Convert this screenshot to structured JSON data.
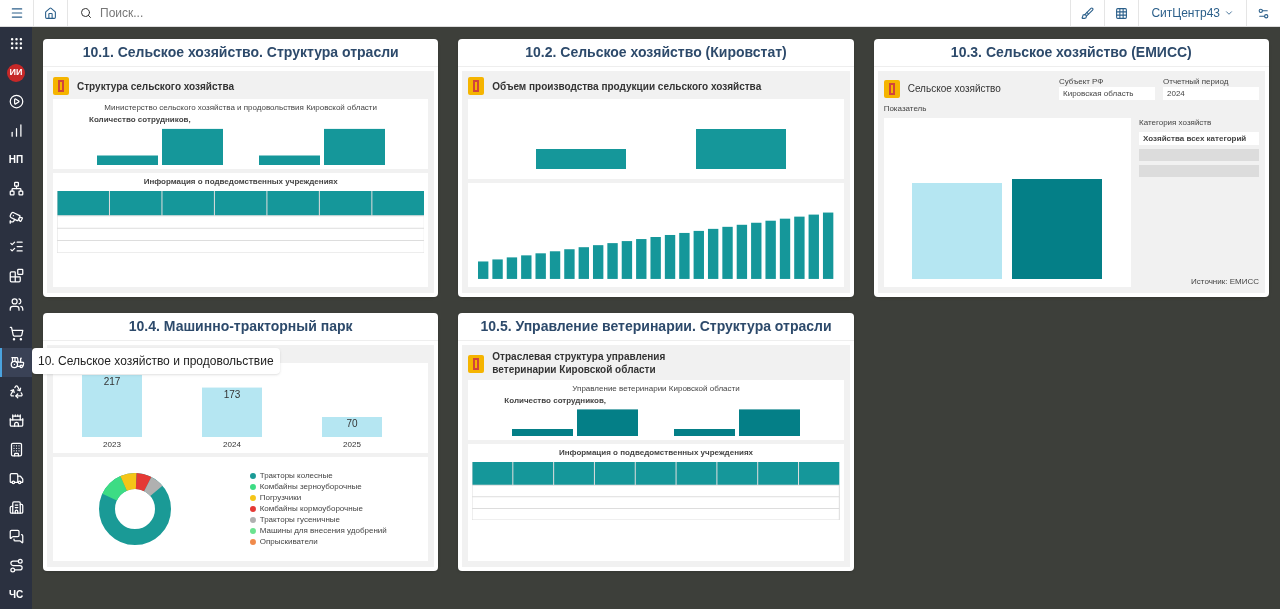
{
  "topbar": {
    "search_placeholder": "Поиск...",
    "user": "СитЦентр43"
  },
  "sidebar": {
    "items": [
      {
        "kind": "icon",
        "selected": false
      },
      {
        "kind": "badge",
        "label": "ИИ",
        "selected": false
      },
      {
        "kind": "icon",
        "selected": false
      },
      {
        "kind": "icon",
        "selected": false
      },
      {
        "kind": "text",
        "label": "НП",
        "selected": false
      },
      {
        "kind": "icon",
        "selected": false
      },
      {
        "kind": "icon",
        "selected": false
      },
      {
        "kind": "icon",
        "selected": false
      },
      {
        "kind": "icon",
        "selected": false
      },
      {
        "kind": "icon",
        "selected": false
      },
      {
        "kind": "icon",
        "selected": false
      },
      {
        "kind": "icon",
        "selected": true
      },
      {
        "kind": "icon",
        "selected": false
      },
      {
        "kind": "icon",
        "selected": false
      },
      {
        "kind": "icon",
        "selected": false
      },
      {
        "kind": "icon",
        "selected": false
      },
      {
        "kind": "icon",
        "selected": false
      },
      {
        "kind": "icon",
        "selected": false
      },
      {
        "kind": "icon",
        "selected": false
      },
      {
        "kind": "text",
        "label": "ЧС",
        "selected": false
      }
    ],
    "tooltip": "10. Сельское хозяйство и продовольствие"
  },
  "cards": [
    {
      "kind": "structure",
      "title": "10.1. Сельское хозяйство. Структура отрасли",
      "heading": "Структура сельского хозяйства",
      "subtitle": "Министерство сельского хозяйства и продовольствия Кировской области",
      "metric": "Количество сотрудников,",
      "table_title": "Информация о подведомственных учреждениях"
    },
    {
      "kind": "production",
      "title": "10.2. Сельское хозяйство (Кировстат)",
      "heading": "Объем производства продукции сельского хозяйства"
    },
    {
      "kind": "emiss",
      "title": "10.3. Сельское хозяйство (ЕМИСС)",
      "heading": "Сельское хозяйство",
      "filters": [
        {
          "label": "Субъект РФ",
          "value": "Кировская область"
        },
        {
          "label": "Отчетный период",
          "value": "2024"
        }
      ],
      "indicator_label": "Показатель",
      "side_label": "Категория хозяйств",
      "side_value": "Хозяйства всех категорий",
      "source": "Источник: ЕМИСС"
    },
    {
      "kind": "tractors",
      "title": "10.4. Машинно-тракторный парк",
      "chart_data": {
        "type": "bar",
        "categories": [
          "2023",
          "2024",
          "2025"
        ],
        "values": [
          217,
          173,
          70
        ],
        "data_labels": true
      },
      "legend": [
        {
          "label": "Тракторы колесные",
          "color": "#1a9a96"
        },
        {
          "label": "Комбайны зерноуборочные",
          "color": "#3ddc84"
        },
        {
          "label": "Погрузчики",
          "color": "#f5c518"
        },
        {
          "label": "Комбайны кормоуборочные",
          "color": "#e53935"
        },
        {
          "label": "Тракторы гусеничные",
          "color": "#b0b0b0"
        },
        {
          "label": "Машины для внесения удобрений",
          "color": "#6be38f"
        },
        {
          "label": "Опрыскиватели",
          "color": "#f08a4b"
        }
      ]
    },
    {
      "kind": "vet",
      "title": "10.5. Управление ветеринарии. Структура отрасли",
      "heading": "Отраслевая структура управления ветеринарии Кировской области",
      "subtitle": "Управление ветеринарии Кировской области",
      "metric": "Количество сотрудников,",
      "table_title": "Информация о подведомственных учреждениях"
    }
  ]
}
